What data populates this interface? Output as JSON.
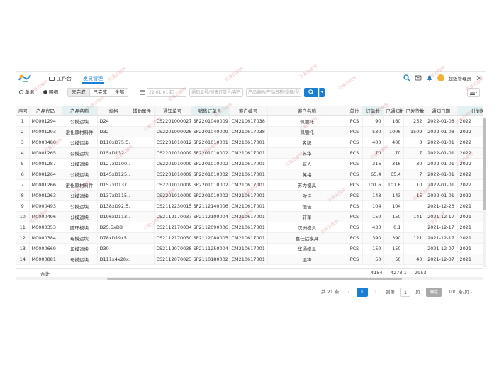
{
  "header": {
    "tabs": [
      {
        "label": "工作台"
      },
      {
        "label": "发货管理"
      }
    ],
    "user_name": "超级管理员",
    "accent_color": "#1a7fd4"
  },
  "filters": {
    "mode_options": [
      "单据",
      "明细"
    ],
    "mode_selected": "明细",
    "status_options": [
      "未完成",
      "已完成",
      "全部"
    ],
    "status_selected": "未完成",
    "date_placeholder": "22-01-01 起",
    "order_placeholder": "通知单号/销售订单号/客户",
    "product_placeholder": "产品编码/产品名称/规格/型"
  },
  "table": {
    "columns": [
      "序号",
      "产品代码",
      "产品名称",
      "规格",
      "辅助属性",
      "通知单号",
      "销售订单号",
      "客户编号",
      "客户名称",
      "单位",
      "订单数",
      "已通知数",
      "已发货数",
      "通知日期",
      "计划发货"
    ],
    "rows": [
      [
        "1",
        "M0001294",
        "公模运块",
        "D24",
        "",
        "CS2201000027",
        "SP2201040009",
        "CM210617038",
        "佩丽托",
        "PCS",
        "90",
        "160",
        "252",
        "2022-01-08",
        "2022"
      ],
      [
        "2",
        "M0001293",
        "滚化原材料件",
        "D32",
        "",
        "CS2201000026",
        "SP2201040009",
        "CM210617038",
        "佩丽托",
        "PCS",
        "530",
        "1006",
        "1509",
        "2022-01-08",
        "2022"
      ],
      [
        "3",
        "M0000480",
        "公模运块",
        "D110xD75.5...",
        "",
        "CS2201010012",
        "SP2201010001",
        "CM210617001",
        "名牌",
        "PCS",
        "400",
        "400",
        "0",
        "2022-01-01",
        "2022"
      ],
      [
        "4",
        "M0001265",
        "公模运块",
        "D15xD132...",
        "",
        "CS2201010009",
        "SP2201010002",
        "CM210617001",
        "苏华",
        "PCS",
        "70",
        "70",
        "7",
        "2022-01-01",
        "2022"
      ],
      [
        "5",
        "M0001287",
        "公模运块",
        "D127xD100...",
        "",
        "CS2201010009",
        "SP2201010002",
        "CM210617001",
        "新人",
        "PCS",
        "316",
        "316",
        "30",
        "2022-01-01",
        "2022"
      ],
      [
        "6",
        "M0001264",
        "公模运块",
        "D145xD125...",
        "",
        "CS2201010009",
        "SP2201010002",
        "CM210617001",
        "英格",
        "PCS",
        "65.4",
        "65.4",
        "7",
        "2022-01-01",
        "2022"
      ],
      [
        "7",
        "M0001266",
        "滚化原材料件",
        "D157xD137...",
        "",
        "CS2201010009",
        "SP2201010002",
        "CM210617001",
        "苏力模具",
        "PCS",
        "101.6",
        "101.6",
        "10",
        "2022-01-01",
        "2022"
      ],
      [
        "8",
        "M0001263",
        "公模运块",
        "D137xD115...",
        "",
        "CS2201010009",
        "SP2201010002",
        "CM210617001",
        "欧佳",
        "PCS",
        "143",
        "143",
        "15",
        "2022-01-01",
        "2022"
      ],
      [
        "9",
        "M0000493",
        "公模运块",
        "D138xD92.5...",
        "",
        "CS2112230015",
        "SP2112140006",
        "CM210617001",
        "恒佳",
        "PCS",
        "104",
        "104",
        "",
        "2021-12-23",
        "2021"
      ],
      [
        "10",
        "M0000496",
        "公模运块",
        "D196xD113...",
        "",
        "CS2112170037",
        "SP2112100004",
        "CM210617001",
        "轩華",
        "PCS",
        "150",
        "150",
        "141",
        "2021-12-17",
        "2021"
      ],
      [
        "11",
        "M0000353",
        "圆环模块",
        "D25.5xD8",
        "",
        "CS2112170034",
        "SP2112090006",
        "CM210617001",
        "汉洲模具",
        "PCS",
        "430",
        "0.1",
        "",
        "2021-12-17",
        "2021"
      ],
      [
        "12",
        "M0000384",
        "母模运块",
        "D78xD19x5...",
        "",
        "CS2112170030",
        "SP2112080005",
        "CM210617001",
        "富仕铝模具",
        "PCS",
        "390",
        "390",
        "121",
        "2021-12-17",
        "2021"
      ],
      [
        "13",
        "M0000669",
        "母模运块",
        "D30",
        "",
        "CS2112070038",
        "SP2111250004",
        "CM210617001",
        "华通模具",
        "PCS",
        "150",
        "150",
        "",
        "2021-12-07",
        "2021"
      ],
      [
        "14",
        "M0000881",
        "母模运块",
        "D111x4x28x...",
        "",
        "CS2112070023",
        "SP2110180002",
        "CM210617001",
        "远锋",
        "PCS",
        "50",
        "50",
        "40",
        "2021-12-07",
        "2021"
      ]
    ],
    "totals_label": "合计",
    "totals": {
      "order": "4154",
      "notified": "4278.1",
      "shipped": "2953"
    }
  },
  "pagination": {
    "total_text": "共 21 条",
    "current_page": "1",
    "goto_label": "到第",
    "goto_value": "1",
    "page_unit": "页",
    "ok_label": "确定",
    "page_size": "100 条/页"
  },
  "watermark": "云易云软件"
}
